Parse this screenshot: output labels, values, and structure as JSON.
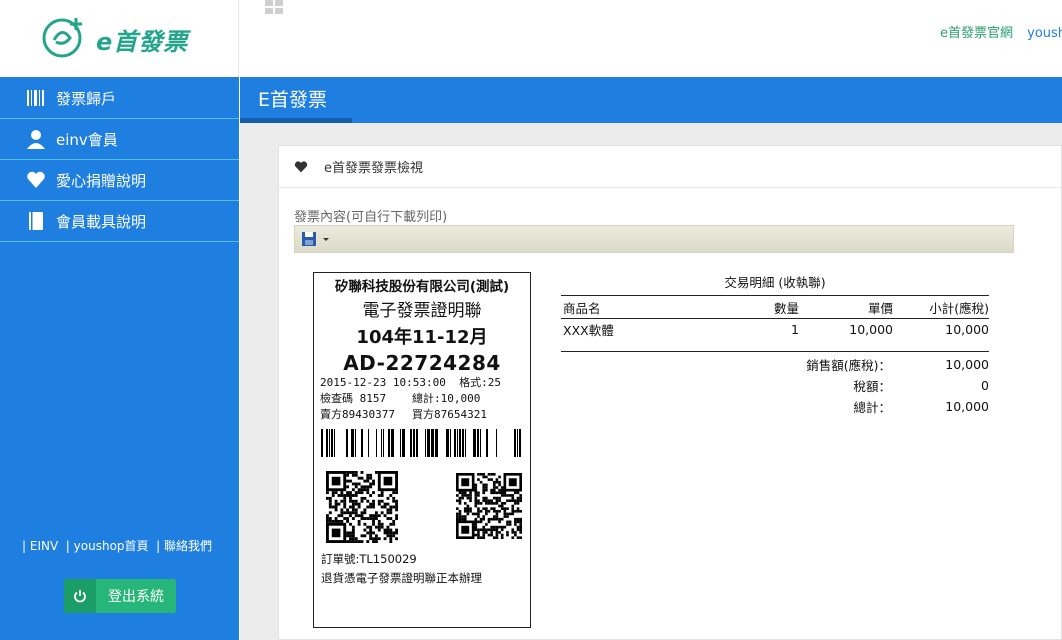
{
  "brand": {
    "name": "e首發票"
  },
  "sidebar": {
    "items": [
      {
        "label": "發票歸戶",
        "icon": "barcode-icon"
      },
      {
        "label": "einv會員",
        "icon": "user-icon"
      },
      {
        "label": "愛心捐贈說明",
        "icon": "heart-icon"
      },
      {
        "label": "會員載具說明",
        "icon": "book-icon"
      }
    ],
    "footer_links": [
      {
        "label": "EINV"
      },
      {
        "label": "youshop首頁"
      },
      {
        "label": "聯絡我們"
      }
    ],
    "logout_label": "登出系統"
  },
  "topbar": {
    "link1": "e首發票官網",
    "link2": "yousho"
  },
  "page": {
    "title": "E首發票"
  },
  "panel": {
    "heading": "e首發票發票檢視",
    "sub_label": "發票內容(可自行下載列印)"
  },
  "receipt": {
    "company": "矽聯科技股份有限公司(測試)",
    "title": "電子發票證明聯",
    "period": "104年11-12月",
    "number": "AD-22724284",
    "datetime": "2015-12-23 10:53:00",
    "format": "格式:25",
    "check_code": "檢查碼 8157",
    "total": "總計:10,000",
    "seller": "賣方89430377",
    "buyer": "買方87654321",
    "order": "訂單號:TL150029",
    "note": "退貨憑電子發票證明聯正本辦理"
  },
  "detail": {
    "title": "交易明細 (收執聯)",
    "headers": [
      "商品名",
      "數量",
      "單價",
      "小計(應稅)"
    ],
    "rows": [
      [
        "XXX軟體",
        "1",
        "10,000",
        "10,000"
      ]
    ],
    "summary": [
      {
        "label": "銷售額(應稅)：",
        "value": "10,000"
      },
      {
        "label": "稅額：",
        "value": "0"
      },
      {
        "label": "總計：",
        "value": "10,000"
      }
    ]
  }
}
